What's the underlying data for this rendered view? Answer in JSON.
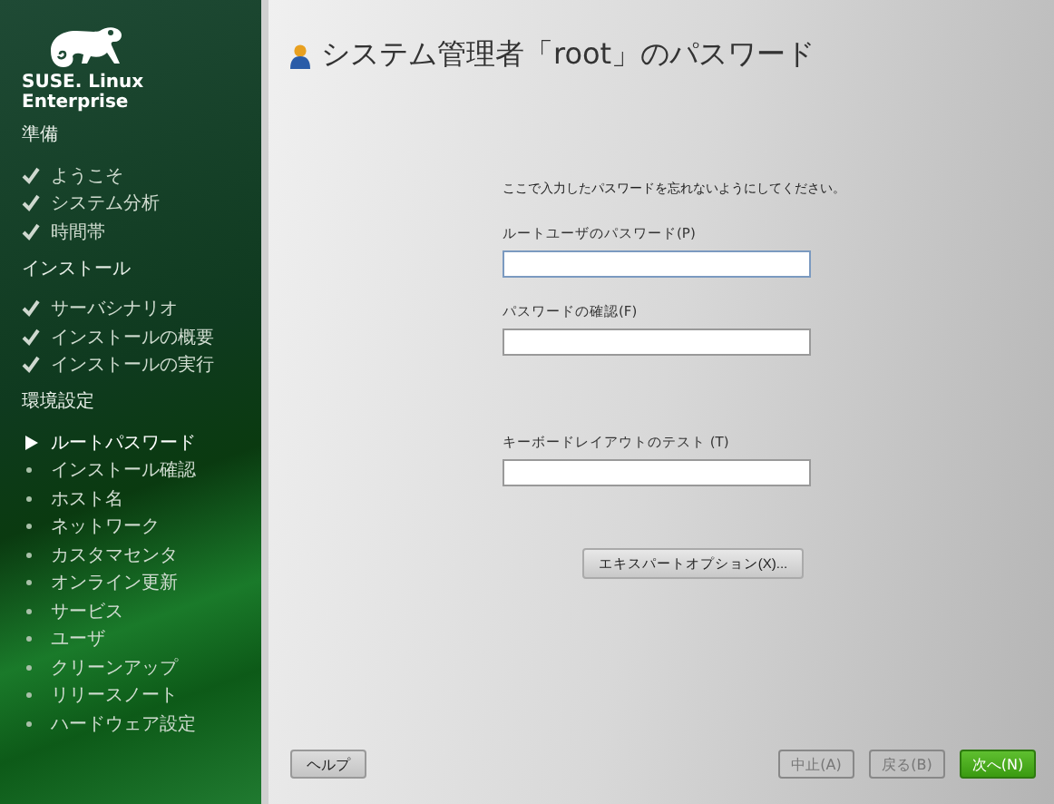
{
  "sidebar": {
    "brand": "SUSE. Linux Enterprise",
    "sections": [
      {
        "title": "準備",
        "items": [
          {
            "label": "ようこそ",
            "kind": "done"
          },
          {
            "label": "システム分析",
            "kind": "done"
          },
          {
            "label": "時間帯",
            "kind": "done"
          }
        ]
      },
      {
        "title": "インストール",
        "items": [
          {
            "label": "サーバシナリオ",
            "kind": "done"
          },
          {
            "label": "インストールの概要",
            "kind": "done"
          },
          {
            "label": "インストールの実行",
            "kind": "done"
          }
        ]
      },
      {
        "title": "環境設定",
        "items": [
          {
            "label": "ルートパスワード",
            "kind": "current"
          },
          {
            "label": "インストール確認",
            "kind": "todo"
          },
          {
            "label": "ホスト名",
            "kind": "todo"
          },
          {
            "label": "ネットワーク",
            "kind": "todo"
          },
          {
            "label": "カスタマセンタ",
            "kind": "todo"
          },
          {
            "label": "オンライン更新",
            "kind": "todo"
          },
          {
            "label": "サービス",
            "kind": "todo"
          },
          {
            "label": "ユーザ",
            "kind": "todo"
          },
          {
            "label": "クリーンアップ",
            "kind": "todo"
          },
          {
            "label": "リリースノート",
            "kind": "todo"
          },
          {
            "label": "ハードウェア設定",
            "kind": "todo"
          }
        ]
      }
    ]
  },
  "page_title": "システム管理者「root」のパスワード",
  "instruction": "ここで入力したパスワードを忘れないようにしてください。",
  "fields": [
    {
      "label": "ルートユーザのパスワード(P)"
    },
    {
      "label": "パスワードの確認(F)"
    },
    {
      "label": "キーボードレイアウトのテスト (T)"
    }
  ],
  "expert_button": "エキスパートオプション(X)...",
  "buttons": [
    {
      "label": "ヘルプ",
      "kind": "help",
      "disabled": false
    },
    {
      "label": "中止(A)",
      "kind": "abort",
      "disabled": true
    },
    {
      "label": "戻る(B)",
      "kind": "back",
      "disabled": true
    },
    {
      "label": "次へ(N)",
      "kind": "next",
      "disabled": false
    }
  ]
}
